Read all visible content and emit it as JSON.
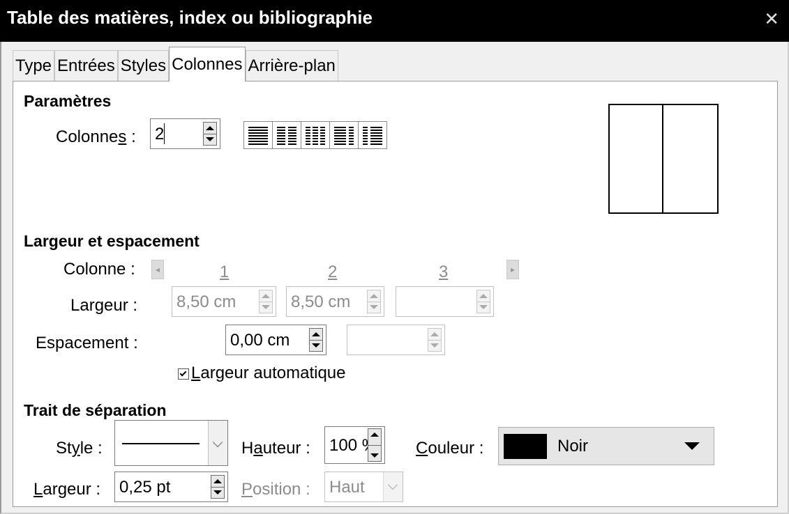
{
  "window": {
    "title": "Table des matières, index ou bibliographie"
  },
  "tabs": [
    {
      "label": "Type"
    },
    {
      "label": "Entrées"
    },
    {
      "label": "Styles"
    },
    {
      "label": "Colonnes"
    },
    {
      "label": "Arrière-plan"
    }
  ],
  "active_tab": "Colonnes",
  "parametres": {
    "title": "Paramètres",
    "colonnes_label_pre": "Colonne",
    "colonnes_label_mnemonic": "s",
    "colonnes_label_post": " :",
    "colonnes_value": "2",
    "layout_icons": [
      "one-column-icon",
      "two-columns-icon",
      "three-columns-icon",
      "left-wide-columns-icon",
      "right-wide-columns-icon"
    ]
  },
  "largeur_espacement": {
    "title": "Largeur et espacement",
    "colonne_label": "Colonne :",
    "column_numbers": [
      "1",
      "2",
      "3"
    ],
    "largeur_label_pre": "Lar",
    "largeur_label_mnemonic": "g",
    "largeur_label_post": "eur :",
    "largeur_values": [
      "8,50 cm",
      "8,50 cm",
      ""
    ],
    "espacement_label": "Espacement :",
    "espacement_values": [
      "0,00 cm",
      ""
    ],
    "auto_width_mnemonic": "L",
    "auto_width_rest": "argeur automatique",
    "auto_width_checked": true
  },
  "separateur": {
    "title": "Trait de séparation",
    "style_label_pre": "St",
    "style_label_mnemonic": "y",
    "style_label_post": "le :",
    "hauteur_label_pre": "H",
    "hauteur_label_mnemonic": "a",
    "hauteur_label_post": "uteur :",
    "hauteur_value": "100 %",
    "couleur_label_mnemonic": "C",
    "couleur_label_post": "ouleur :",
    "couleur_name": "Noir",
    "couleur_hex": "#000000",
    "largeur_label_mnemonic": "L",
    "largeur_label_post": "argeur :",
    "largeur_value": "0,25 pt",
    "position_label_mnemonic": "P",
    "position_label_post": "osition :",
    "position_value": "Haut"
  }
}
